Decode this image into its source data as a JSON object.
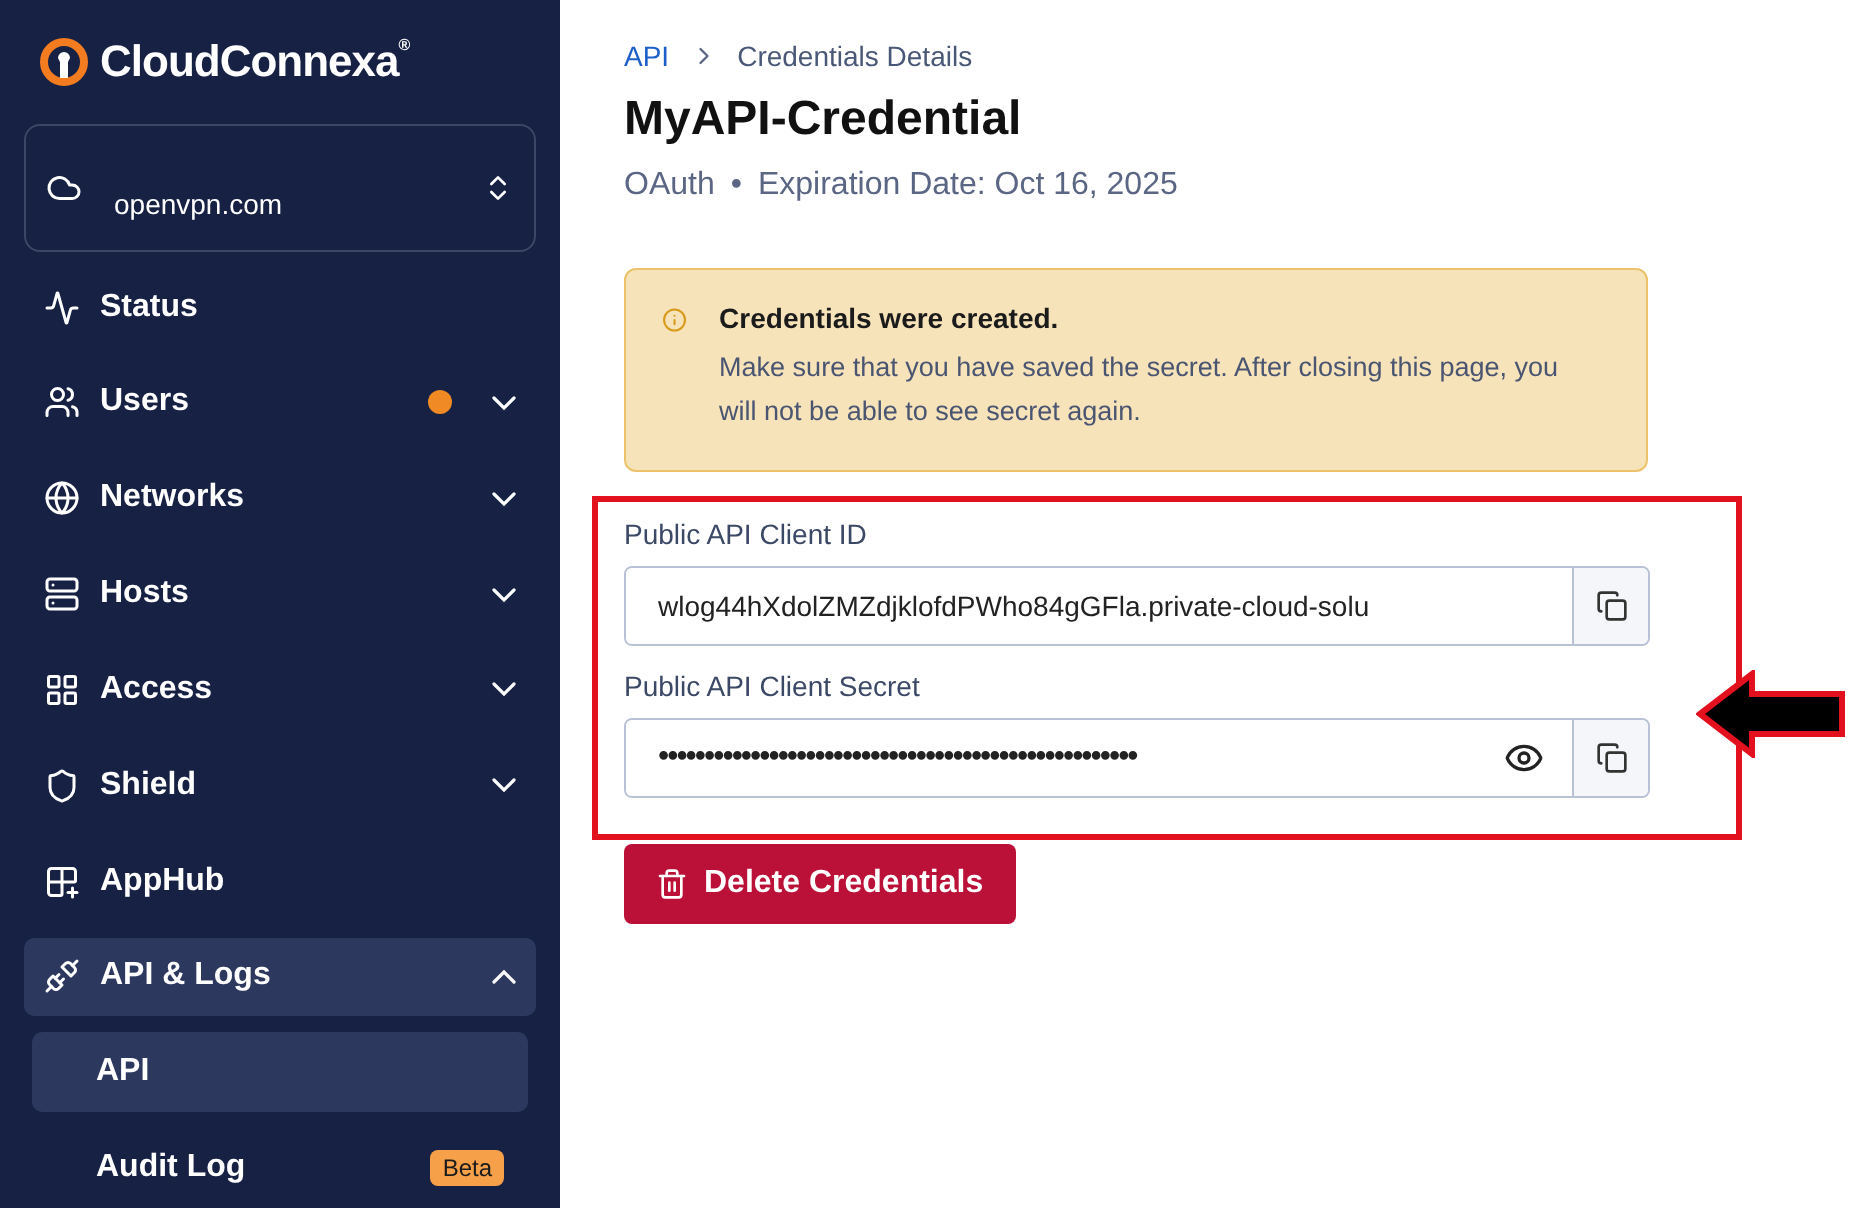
{
  "sidebar": {
    "brand": "CloudConnexa",
    "brand_mark": "®",
    "workspace": "openvpn.com",
    "items": [
      {
        "label": "Status",
        "selected": false,
        "expandable": false,
        "expanded": false,
        "dot": false
      },
      {
        "label": "Users",
        "selected": false,
        "expandable": true,
        "expanded": false,
        "dot": true
      },
      {
        "label": "Networks",
        "selected": false,
        "expandable": true,
        "expanded": false,
        "dot": false
      },
      {
        "label": "Hosts",
        "selected": false,
        "expandable": true,
        "expanded": false,
        "dot": false
      },
      {
        "label": "Access",
        "selected": false,
        "expandable": true,
        "expanded": false,
        "dot": false
      },
      {
        "label": "Shield",
        "selected": false,
        "expandable": true,
        "expanded": false,
        "dot": false
      },
      {
        "label": "AppHub",
        "selected": false,
        "expandable": false,
        "expanded": false,
        "dot": false
      },
      {
        "label": "API & Logs",
        "selected": true,
        "expandable": true,
        "expanded": true,
        "dot": false,
        "children": [
          {
            "label": "API",
            "selected": true
          },
          {
            "label": "Audit Log",
            "selected": false,
            "badge": "Beta"
          }
        ]
      }
    ]
  },
  "breadcrumb": [
    {
      "label": "API",
      "link": true
    },
    {
      "label": "Credentials Details",
      "link": false
    }
  ],
  "title": "MyAPI-Credential",
  "meta": [
    "OAuth",
    "•",
    "Expiration Date: Oct 16, 2025"
  ],
  "alert": {
    "title": "Credentials were created.",
    "message": "Make sure that you have saved the secret. After closing this page, you will not be able to see secret again."
  },
  "fields": [
    {
      "label": "Public API Client ID",
      "value": "wlog44hXdolZMZdjklofdPWho84gGFla.private-cloud-solu",
      "masked": false
    },
    {
      "label": "Public API Client Secret",
      "value": "••••••••••••••••••••••••••••••••••••••••••••••••••••",
      "masked": true
    }
  ],
  "delete_button": "Delete Credentials"
}
